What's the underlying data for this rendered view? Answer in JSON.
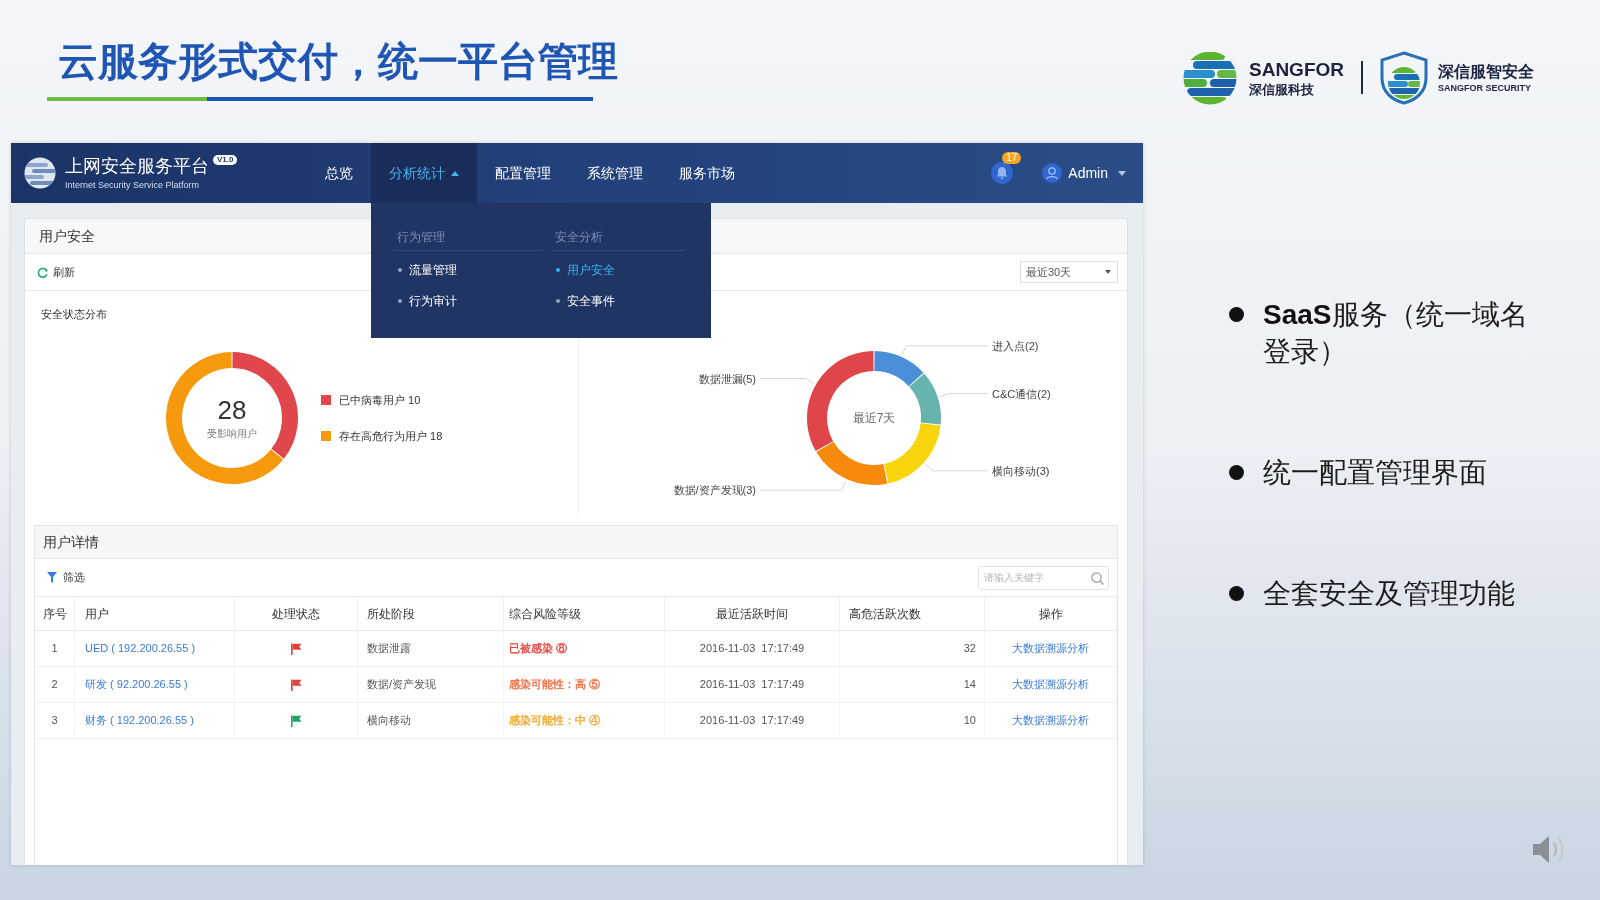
{
  "slide": {
    "title": "云服务形式交付，统一平台管理",
    "bullets": [
      "**SaaS**服务（统一域名登录）",
      "统一配置管理界面",
      "全套安全及管理功能"
    ]
  },
  "logos": [
    {
      "kind": "globe",
      "name": "SANGFOR",
      "tagline": "深信服科技"
    },
    {
      "kind": "shield",
      "name": "深信服智安全",
      "tagline": "SANGFOR SECURITY"
    }
  ],
  "app": {
    "header": {
      "title": "上网安全服务平台",
      "version": "V1.0",
      "subtitle": "Internet Security Service Platform",
      "nav": [
        {
          "label": "总览",
          "selected": false
        },
        {
          "label": "分析统计",
          "selected": true,
          "expanded": true,
          "menu": [
            {
              "heading": "行为管理",
              "items": [
                {
                  "label": "流量管理",
                  "selected": false
                },
                {
                  "label": "行为审计",
                  "selected": false
                }
              ]
            },
            {
              "heading": "安全分析",
              "items": [
                {
                  "label": "用户安全",
                  "selected": true
                },
                {
                  "label": "安全事件",
                  "selected": false
                }
              ]
            }
          ]
        },
        {
          "label": "配置管理",
          "selected": false
        },
        {
          "label": "系统管理",
          "selected": false
        },
        {
          "label": "服务市场",
          "selected": false
        }
      ],
      "notifications": "17",
      "user": "Admin"
    },
    "user_security": {
      "title": "用户安全",
      "refresh": "刷新",
      "range": "最近30天",
      "section_title": "安全状态分布",
      "status_chart": {
        "center_value": "28",
        "center_label": "受影响用户",
        "chart_data": {
          "type": "donut",
          "categories": [
            "已中病毒用户 10",
            "存在高危行为用户 18"
          ],
          "values": [
            10,
            18
          ],
          "colors": [
            "#e0474c",
            "#f7990c"
          ],
          "legend": "right"
        }
      },
      "event_chart": {
        "center_label": "最近7天",
        "chart_data": {
          "type": "donut",
          "categories": [
            "进入点(2)",
            "C&C通信(2)",
            "横向移动(3)",
            "数据/资产发现(3)",
            "数据泄漏(5)"
          ],
          "values": [
            2,
            2,
            3,
            3,
            5
          ],
          "colors": [
            "#4a8fd8",
            "#67b3ad",
            "#f7d40c",
            "#f78a0c",
            "#e0454a"
          ]
        }
      }
    },
    "user_details": {
      "title": "用户详情",
      "filter": "筛选",
      "search": {
        "placeholder": "请输入关键字"
      },
      "table": {
        "columns": [
          "序号",
          "用户",
          "处理状态",
          "所处阶段",
          "综合风险等级",
          "最近活跃时间",
          "高危活跃次数",
          "操作"
        ],
        "rows": [
          {
            "index": "1",
            "user": "UED ( 192.200.26.55 )",
            "flag": {
              "color": "#e5403a"
            },
            "stage": "数据泄露",
            "risk": {
              "text": "已被感染 ⑧",
              "color": "#e5403a"
            },
            "last_active": "2016-11-03  17:17:49",
            "high_risk_count": "32",
            "action": "大数据溯源分析"
          },
          {
            "index": "2",
            "user": "研发 ( 92.200.26.55 )",
            "flag": {
              "color": "#e5403a"
            },
            "stage": "数据/资产发现",
            "risk": {
              "text": "感染可能性：高 ⑤",
              "color": "#f26a3d"
            },
            "last_active": "2016-11-03  17:17:49",
            "high_risk_count": "14",
            "action": "大数据溯源分析"
          },
          {
            "index": "3",
            "user": "财务 ( 192.200.26.55 )",
            "flag": {
              "color": "#1ea36b"
            },
            "stage": "横向移动",
            "risk": {
              "text": "感染可能性：中 ④",
              "color": "#f5a321"
            },
            "last_active": "2016-11-03  17:17:49",
            "high_risk_count": "10",
            "action": "大数据溯源分析"
          }
        ]
      }
    }
  }
}
